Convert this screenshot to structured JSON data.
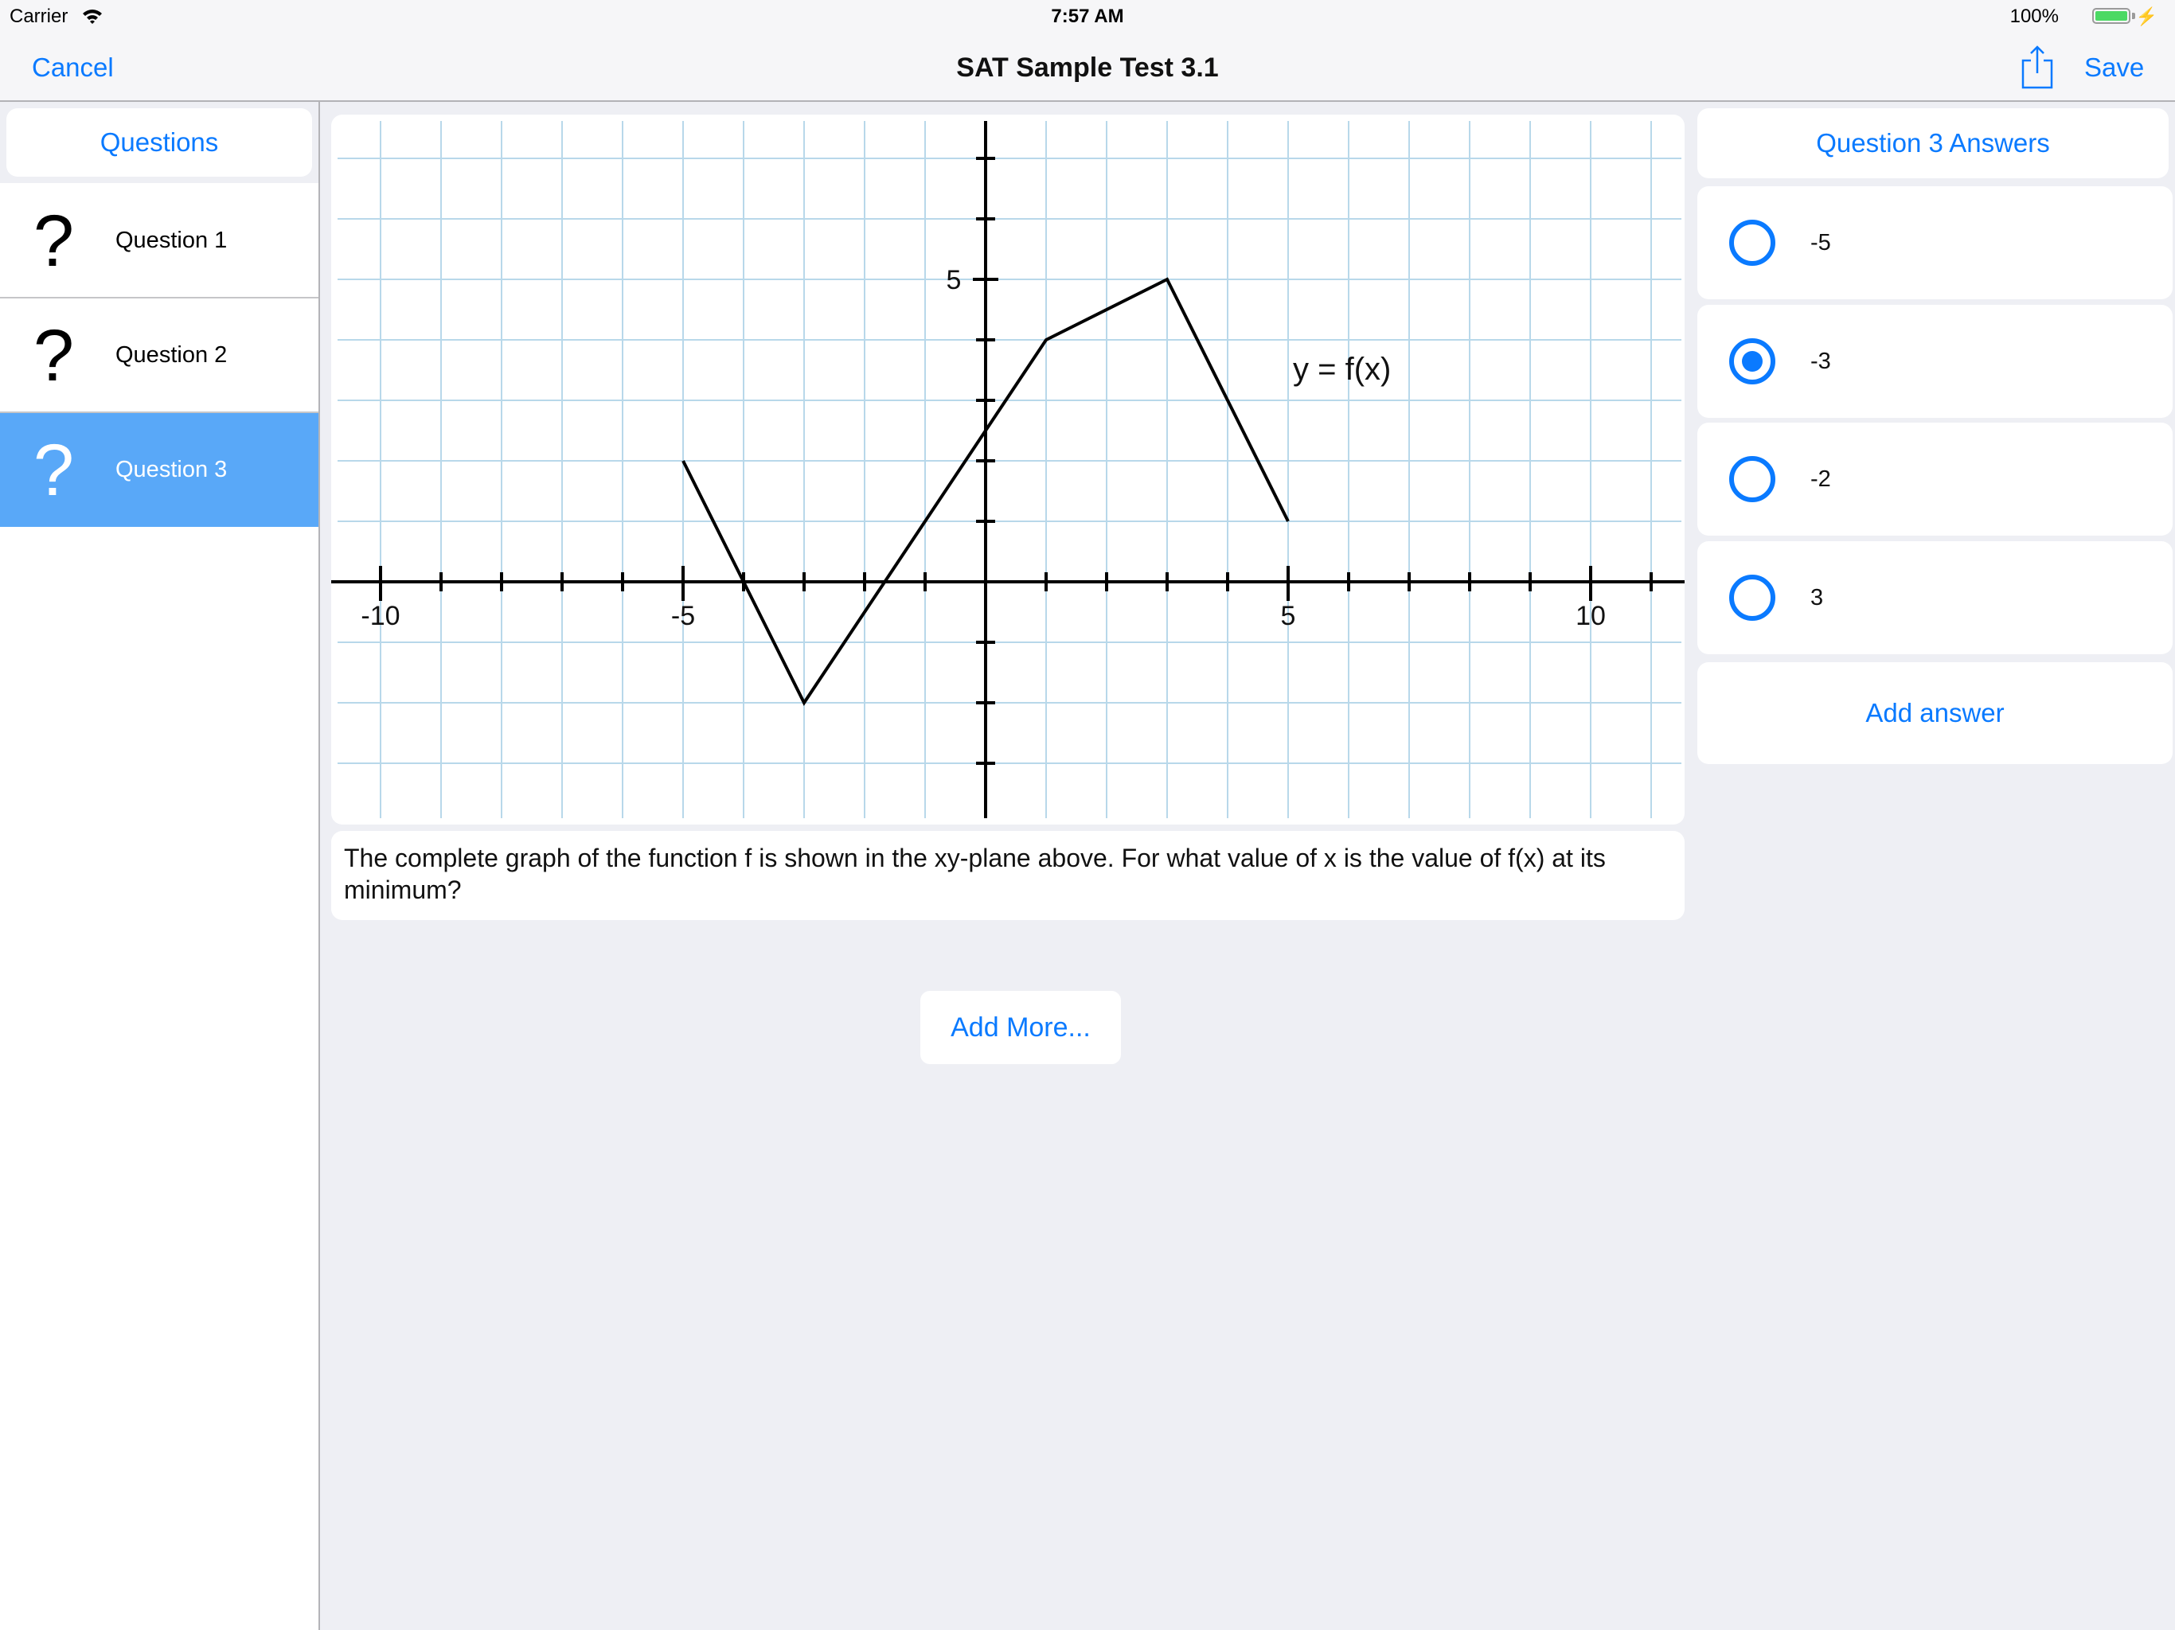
{
  "status_bar": {
    "carrier": "Carrier",
    "wifi_icon": "wifi-icon",
    "time": "7:57 AM",
    "battery_percent": "100%",
    "battery_level": 1.0,
    "charging_icon": "⚡"
  },
  "nav": {
    "cancel_label": "Cancel",
    "title": "SAT Sample Test 3.1",
    "share_icon": "share-icon",
    "save_label": "Save"
  },
  "sidebar": {
    "header": "Questions",
    "icon_glyph": "?",
    "items": [
      {
        "label": "Question 1",
        "selected": false
      },
      {
        "label": "Question 2",
        "selected": false
      },
      {
        "label": "Question 3",
        "selected": true
      }
    ]
  },
  "question": {
    "text": "The complete graph of the function f is shown in the xy-plane above. For what value of x is the value of f(x) at its minimum?",
    "add_more_label": "Add More..."
  },
  "answers": {
    "header": "Question 3 Answers",
    "options": [
      {
        "label": "-5",
        "selected": false
      },
      {
        "label": "-3",
        "selected": true
      },
      {
        "label": "-2",
        "selected": false
      },
      {
        "label": "3",
        "selected": false
      }
    ],
    "add_answer_label": "Add answer"
  },
  "colors": {
    "accent": "#0a7aff",
    "selected_row": "#59a8f8",
    "grid": "#b8d8ea",
    "background": "#eeeff4"
  },
  "chart_data": {
    "type": "line",
    "series": [
      {
        "name": "y = f(x)",
        "x": [
          -5,
          -3,
          1,
          3,
          5
        ],
        "y": [
          2,
          -2,
          4,
          5,
          1
        ]
      }
    ],
    "annotation": "y = f(x)",
    "annotation_anchor": {
      "x": 5.5,
      "y": 3.5
    },
    "x_tick_labels": [
      {
        "value": -10,
        "label": "-10"
      },
      {
        "value": -5,
        "label": "-5"
      },
      {
        "value": 5,
        "label": "5"
      },
      {
        "value": 10,
        "label": "10"
      }
    ],
    "y_tick_labels": [
      {
        "value": 5,
        "label": "5"
      }
    ],
    "x_grid": [
      -10,
      11
    ],
    "y_grid": [
      -3,
      7
    ],
    "xlim": [
      -10.8,
      11.5
    ],
    "ylim": [
      -3.9,
      7.6
    ],
    "grid": true,
    "title": "",
    "xlabel": "",
    "ylabel": ""
  }
}
